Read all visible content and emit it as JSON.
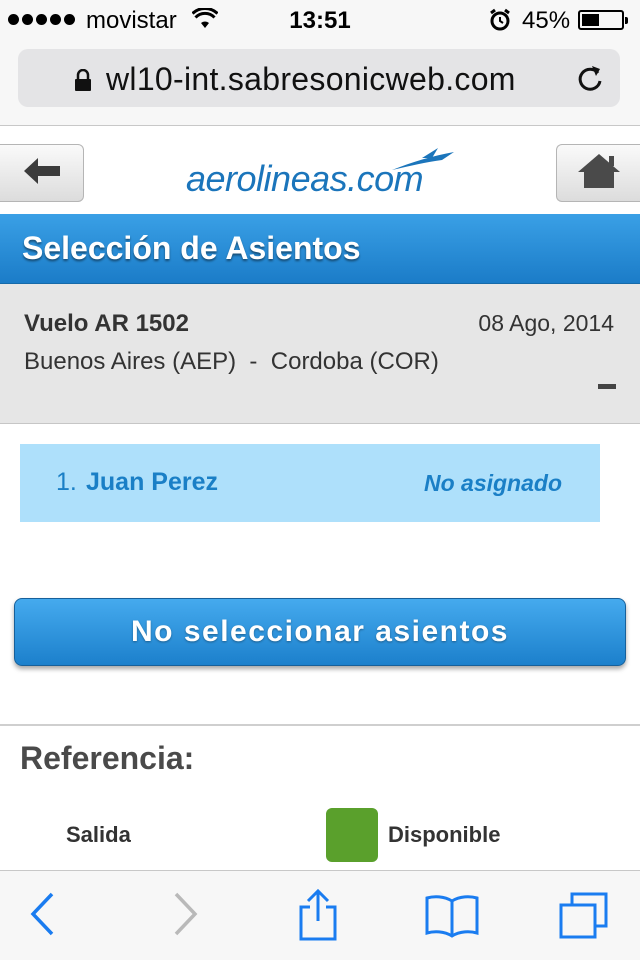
{
  "status_bar": {
    "carrier": "movistar",
    "time": "13:51",
    "battery_percent_text": "45%",
    "battery_level": 0.45
  },
  "browser": {
    "url": "wl10-int.sabresonicweb.com"
  },
  "header": {
    "logo_text": "aerolineas.com"
  },
  "page": {
    "title": "Selección de Asientos"
  },
  "flight": {
    "number": "Vuelo AR 1502",
    "date": "08 Ago, 2014",
    "route": "Buenos Aires (AEP)  -  Cordoba (COR)"
  },
  "passengers": [
    {
      "index": "1.",
      "name": "Juan Perez",
      "seat_status": "No asignado"
    }
  ],
  "actions": {
    "skip_seats_label": "No seleccionar asientos"
  },
  "legend": {
    "title": "Referencia:",
    "items": [
      {
        "label": "Salida"
      },
      {
        "label": "Disponible",
        "color": "#5aa02c"
      }
    ]
  },
  "colors": {
    "accent": "#1b7cc8",
    "passenger_bg": "#aee0fb",
    "ios_blue": "#1a7cf0"
  }
}
